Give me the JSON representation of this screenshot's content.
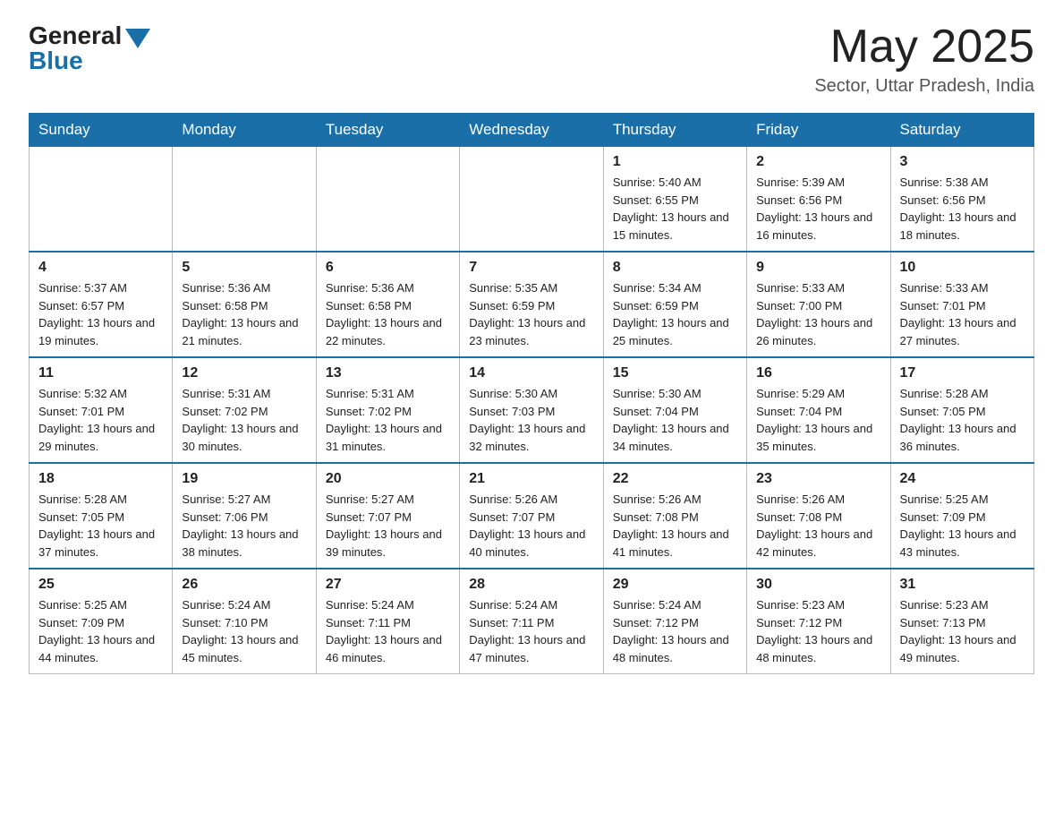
{
  "header": {
    "logo_general": "General",
    "logo_blue": "Blue",
    "month_year": "May 2025",
    "location": "Sector, Uttar Pradesh, India"
  },
  "days_of_week": [
    "Sunday",
    "Monday",
    "Tuesday",
    "Wednesday",
    "Thursday",
    "Friday",
    "Saturday"
  ],
  "weeks": [
    [
      {
        "day": "",
        "sunrise": "",
        "sunset": "",
        "daylight": ""
      },
      {
        "day": "",
        "sunrise": "",
        "sunset": "",
        "daylight": ""
      },
      {
        "day": "",
        "sunrise": "",
        "sunset": "",
        "daylight": ""
      },
      {
        "day": "",
        "sunrise": "",
        "sunset": "",
        "daylight": ""
      },
      {
        "day": "1",
        "sunrise": "Sunrise: 5:40 AM",
        "sunset": "Sunset: 6:55 PM",
        "daylight": "Daylight: 13 hours and 15 minutes."
      },
      {
        "day": "2",
        "sunrise": "Sunrise: 5:39 AM",
        "sunset": "Sunset: 6:56 PM",
        "daylight": "Daylight: 13 hours and 16 minutes."
      },
      {
        "day": "3",
        "sunrise": "Sunrise: 5:38 AM",
        "sunset": "Sunset: 6:56 PM",
        "daylight": "Daylight: 13 hours and 18 minutes."
      }
    ],
    [
      {
        "day": "4",
        "sunrise": "Sunrise: 5:37 AM",
        "sunset": "Sunset: 6:57 PM",
        "daylight": "Daylight: 13 hours and 19 minutes."
      },
      {
        "day": "5",
        "sunrise": "Sunrise: 5:36 AM",
        "sunset": "Sunset: 6:58 PM",
        "daylight": "Daylight: 13 hours and 21 minutes."
      },
      {
        "day": "6",
        "sunrise": "Sunrise: 5:36 AM",
        "sunset": "Sunset: 6:58 PM",
        "daylight": "Daylight: 13 hours and 22 minutes."
      },
      {
        "day": "7",
        "sunrise": "Sunrise: 5:35 AM",
        "sunset": "Sunset: 6:59 PM",
        "daylight": "Daylight: 13 hours and 23 minutes."
      },
      {
        "day": "8",
        "sunrise": "Sunrise: 5:34 AM",
        "sunset": "Sunset: 6:59 PM",
        "daylight": "Daylight: 13 hours and 25 minutes."
      },
      {
        "day": "9",
        "sunrise": "Sunrise: 5:33 AM",
        "sunset": "Sunset: 7:00 PM",
        "daylight": "Daylight: 13 hours and 26 minutes."
      },
      {
        "day": "10",
        "sunrise": "Sunrise: 5:33 AM",
        "sunset": "Sunset: 7:01 PM",
        "daylight": "Daylight: 13 hours and 27 minutes."
      }
    ],
    [
      {
        "day": "11",
        "sunrise": "Sunrise: 5:32 AM",
        "sunset": "Sunset: 7:01 PM",
        "daylight": "Daylight: 13 hours and 29 minutes."
      },
      {
        "day": "12",
        "sunrise": "Sunrise: 5:31 AM",
        "sunset": "Sunset: 7:02 PM",
        "daylight": "Daylight: 13 hours and 30 minutes."
      },
      {
        "day": "13",
        "sunrise": "Sunrise: 5:31 AM",
        "sunset": "Sunset: 7:02 PM",
        "daylight": "Daylight: 13 hours and 31 minutes."
      },
      {
        "day": "14",
        "sunrise": "Sunrise: 5:30 AM",
        "sunset": "Sunset: 7:03 PM",
        "daylight": "Daylight: 13 hours and 32 minutes."
      },
      {
        "day": "15",
        "sunrise": "Sunrise: 5:30 AM",
        "sunset": "Sunset: 7:04 PM",
        "daylight": "Daylight: 13 hours and 34 minutes."
      },
      {
        "day": "16",
        "sunrise": "Sunrise: 5:29 AM",
        "sunset": "Sunset: 7:04 PM",
        "daylight": "Daylight: 13 hours and 35 minutes."
      },
      {
        "day": "17",
        "sunrise": "Sunrise: 5:28 AM",
        "sunset": "Sunset: 7:05 PM",
        "daylight": "Daylight: 13 hours and 36 minutes."
      }
    ],
    [
      {
        "day": "18",
        "sunrise": "Sunrise: 5:28 AM",
        "sunset": "Sunset: 7:05 PM",
        "daylight": "Daylight: 13 hours and 37 minutes."
      },
      {
        "day": "19",
        "sunrise": "Sunrise: 5:27 AM",
        "sunset": "Sunset: 7:06 PM",
        "daylight": "Daylight: 13 hours and 38 minutes."
      },
      {
        "day": "20",
        "sunrise": "Sunrise: 5:27 AM",
        "sunset": "Sunset: 7:07 PM",
        "daylight": "Daylight: 13 hours and 39 minutes."
      },
      {
        "day": "21",
        "sunrise": "Sunrise: 5:26 AM",
        "sunset": "Sunset: 7:07 PM",
        "daylight": "Daylight: 13 hours and 40 minutes."
      },
      {
        "day": "22",
        "sunrise": "Sunrise: 5:26 AM",
        "sunset": "Sunset: 7:08 PM",
        "daylight": "Daylight: 13 hours and 41 minutes."
      },
      {
        "day": "23",
        "sunrise": "Sunrise: 5:26 AM",
        "sunset": "Sunset: 7:08 PM",
        "daylight": "Daylight: 13 hours and 42 minutes."
      },
      {
        "day": "24",
        "sunrise": "Sunrise: 5:25 AM",
        "sunset": "Sunset: 7:09 PM",
        "daylight": "Daylight: 13 hours and 43 minutes."
      }
    ],
    [
      {
        "day": "25",
        "sunrise": "Sunrise: 5:25 AM",
        "sunset": "Sunset: 7:09 PM",
        "daylight": "Daylight: 13 hours and 44 minutes."
      },
      {
        "day": "26",
        "sunrise": "Sunrise: 5:24 AM",
        "sunset": "Sunset: 7:10 PM",
        "daylight": "Daylight: 13 hours and 45 minutes."
      },
      {
        "day": "27",
        "sunrise": "Sunrise: 5:24 AM",
        "sunset": "Sunset: 7:11 PM",
        "daylight": "Daylight: 13 hours and 46 minutes."
      },
      {
        "day": "28",
        "sunrise": "Sunrise: 5:24 AM",
        "sunset": "Sunset: 7:11 PM",
        "daylight": "Daylight: 13 hours and 47 minutes."
      },
      {
        "day": "29",
        "sunrise": "Sunrise: 5:24 AM",
        "sunset": "Sunset: 7:12 PM",
        "daylight": "Daylight: 13 hours and 48 minutes."
      },
      {
        "day": "30",
        "sunrise": "Sunrise: 5:23 AM",
        "sunset": "Sunset: 7:12 PM",
        "daylight": "Daylight: 13 hours and 48 minutes."
      },
      {
        "day": "31",
        "sunrise": "Sunrise: 5:23 AM",
        "sunset": "Sunset: 7:13 PM",
        "daylight": "Daylight: 13 hours and 49 minutes."
      }
    ]
  ]
}
